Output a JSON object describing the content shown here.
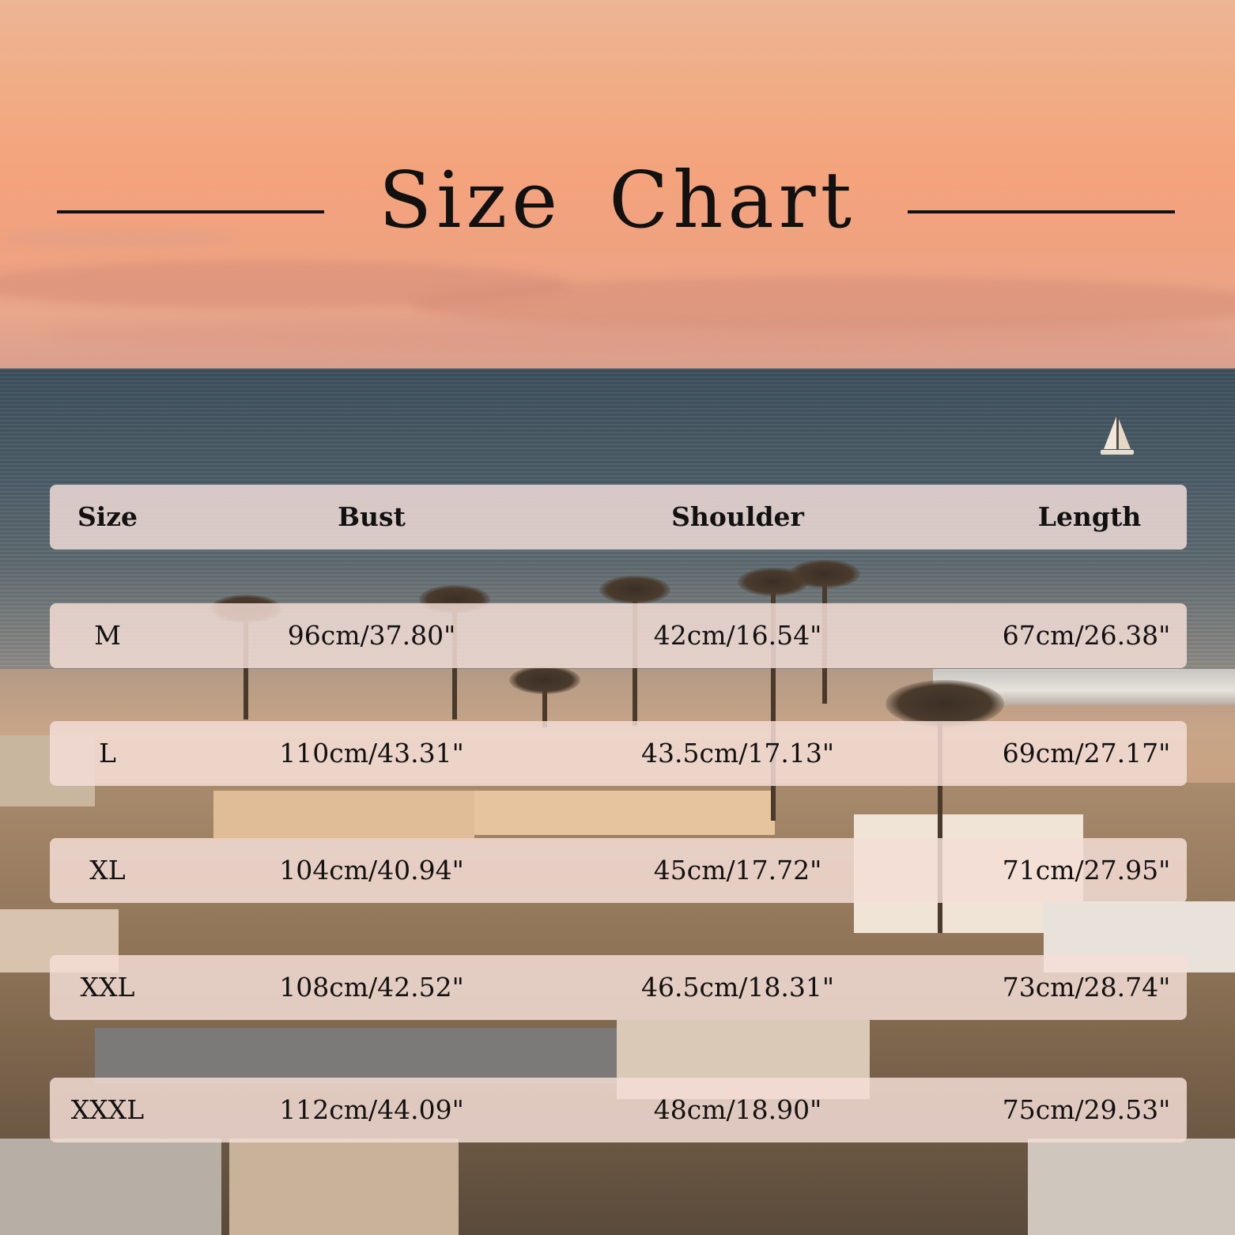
{
  "title": "Size Chart",
  "colors": {
    "text": "#111111",
    "row_background": "#f4ded6"
  },
  "table": {
    "headers": [
      "Size",
      "Bust",
      "Shoulder",
      "Length"
    ],
    "rows": [
      [
        "M",
        "96cm/37.80\"",
        "42cm/16.54\"",
        "67cm/26.38\""
      ],
      [
        "L",
        "110cm/43.31\"",
        "43.5cm/17.13\"",
        "69cm/27.17\""
      ],
      [
        "XL",
        "104cm/40.94\"",
        "45cm/17.72\"",
        "71cm/27.95\""
      ],
      [
        "XXL",
        "108cm/42.52\"",
        "46.5cm/18.31\"",
        "73cm/28.74\""
      ],
      [
        "XXXL",
        "112cm/44.09\"",
        "48cm/18.90\"",
        "75cm/29.53\""
      ]
    ]
  }
}
